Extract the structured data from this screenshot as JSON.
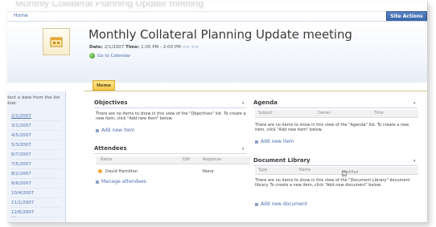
{
  "window": {
    "top_title": "Monthly Collateral Planning Update meeting",
    "breadcrumb": "Home",
    "site_actions": "Site Actions"
  },
  "header": {
    "title": "Monthly Collateral Planning Update meeting",
    "date_label": "Date:",
    "date_value": "2/1/2007",
    "time_label": "Time:",
    "time_value": "1:00 PM - 2:00 PM",
    "nav_arrows": "<< >>",
    "go_to_calendar": "Go to Calendar"
  },
  "tabs": [
    {
      "label": "Home",
      "selected": true
    }
  ],
  "left_nav": {
    "intro": "Select a date from the list below:",
    "dates": [
      "2/1/2007",
      "3/1/2007",
      "4/5/2007",
      "5/3/2007",
      "6/7/2007",
      "7/5/2007",
      "8/2/2007",
      "9/6/2007",
      "10/4/2007",
      "11/1/2007",
      "12/6/2007"
    ],
    "more": "…"
  },
  "objectives": {
    "title": "Objectives",
    "message": "There are no items to show in this view of the \"Objectives\" list. To create a new item, click \"Add new item\" below.",
    "add_link": "Add new item"
  },
  "attendees": {
    "title": "Attendees",
    "columns": [
      "Name",
      "Edit",
      "Response"
    ],
    "rows": [
      {
        "name": "David Hamilton",
        "response": "None"
      }
    ],
    "manage_link": "Manage attendees"
  },
  "agenda": {
    "title": "Agenda",
    "columns": [
      "Subject",
      "Owner",
      "Time"
    ],
    "message": "There are no items to show in this view of the \"Agenda\" list. To create a new item, click \"Add new item\" below.",
    "add_link": "Add new item"
  },
  "document_library": {
    "title": "Document Library",
    "columns": [
      "Type",
      "Name",
      "Modified By"
    ],
    "message": "There are no items to show in this view of the \"Document Library\" document library. To create a new item, click \"Add new document\" below.",
    "add_link": "Add new document"
  },
  "colors": {
    "accent_blue": "#4d6fae",
    "tab_gold": "#f6c84a",
    "site_actions_bg": "#3a64a8"
  }
}
